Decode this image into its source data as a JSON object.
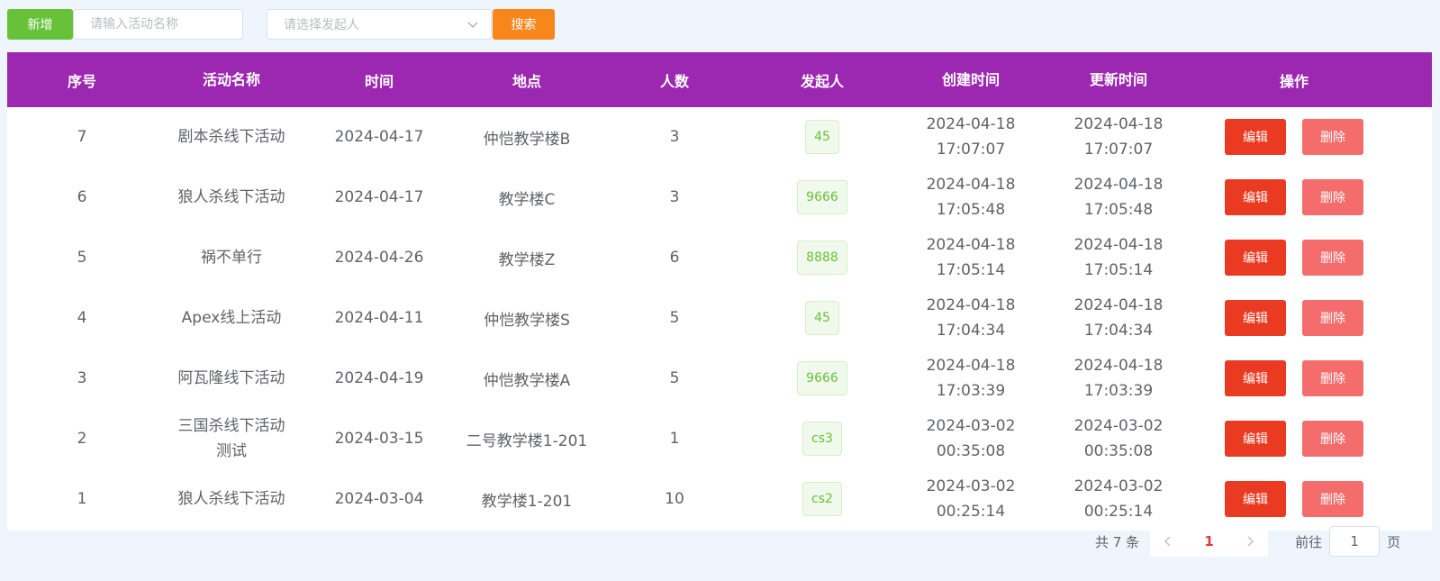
{
  "toolbar": {
    "add_label": "新增",
    "name_placeholder": "请输入活动名称",
    "initiator_placeholder": "请选择发起人",
    "search_label": "搜索"
  },
  "table": {
    "headers": [
      "序号",
      "活动名称",
      "时间",
      "地点",
      "人数",
      "发起人",
      "创建时间",
      "更新时间",
      "操作"
    ],
    "rows": [
      {
        "id": "7",
        "name": "剧本杀线下活动",
        "date": "2024-04-17",
        "place": "仲恺教学楼B",
        "count": "3",
        "initiator": "45",
        "created": "2024-04-18 17:07:07",
        "updated": "2024-04-18 17:07:07"
      },
      {
        "id": "6",
        "name": "狼人杀线下活动",
        "date": "2024-04-17",
        "place": "教学楼C",
        "count": "3",
        "initiator": "9666",
        "created": "2024-04-18 17:05:48",
        "updated": "2024-04-18 17:05:48"
      },
      {
        "id": "5",
        "name": "祸不单行",
        "date": "2024-04-26",
        "place": "教学楼Z",
        "count": "6",
        "initiator": "8888",
        "created": "2024-04-18 17:05:14",
        "updated": "2024-04-18 17:05:14"
      },
      {
        "id": "4",
        "name": "Apex线上活动",
        "date": "2024-04-11",
        "place": "仲恺教学楼S",
        "count": "5",
        "initiator": "45",
        "created": "2024-04-18 17:04:34",
        "updated": "2024-04-18 17:04:34"
      },
      {
        "id": "3",
        "name": "阿瓦隆线下活动",
        "date": "2024-04-19",
        "place": "仲恺教学楼A",
        "count": "5",
        "initiator": "9666",
        "created": "2024-04-18 17:03:39",
        "updated": "2024-04-18 17:03:39"
      },
      {
        "id": "2",
        "name": "三国杀线下活动测试",
        "date": "2024-03-15",
        "place": "二号教学楼1-201",
        "count": "1",
        "initiator": "cs3",
        "created": "2024-03-02 00:35:08",
        "updated": "2024-03-02 00:35:08"
      },
      {
        "id": "1",
        "name": "狼人杀线下活动",
        "date": "2024-03-04",
        "place": "教学楼1-201",
        "count": "10",
        "initiator": "cs2",
        "created": "2024-03-02 00:25:14",
        "updated": "2024-03-02 00:25:14"
      }
    ],
    "edit_label": "编辑",
    "delete_label": "删除"
  },
  "pagination": {
    "total_text": "共 7 条",
    "current_page": "1",
    "goto_prefix": "前往",
    "goto_value": "1",
    "goto_suffix": "页"
  },
  "colors": {
    "header_bg": "#9c27b0",
    "add_button": "#67c23a",
    "search_button": "#f7861b",
    "edit_button": "#ea3b22",
    "delete_button": "#f56c6c",
    "tag_text": "#67c23a"
  }
}
